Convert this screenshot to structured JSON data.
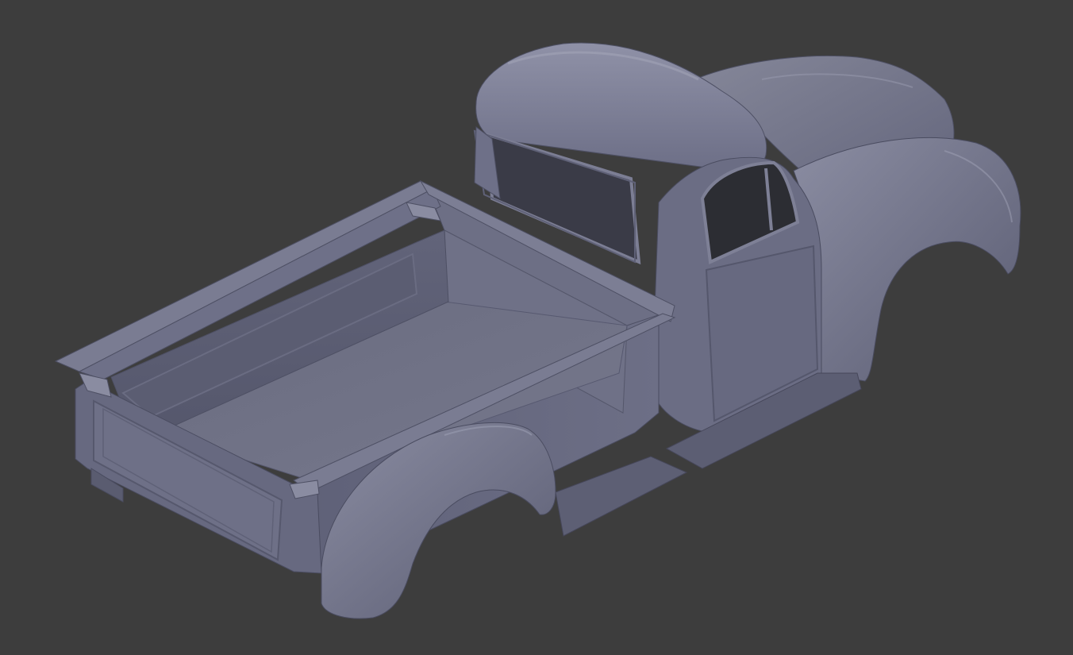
{
  "viewport": {
    "background_color": "#3d3d3d",
    "model_color": "#6e7088",
    "model_highlight_color": "#8e90a6",
    "model_shadow_color": "#4a4b5e"
  }
}
